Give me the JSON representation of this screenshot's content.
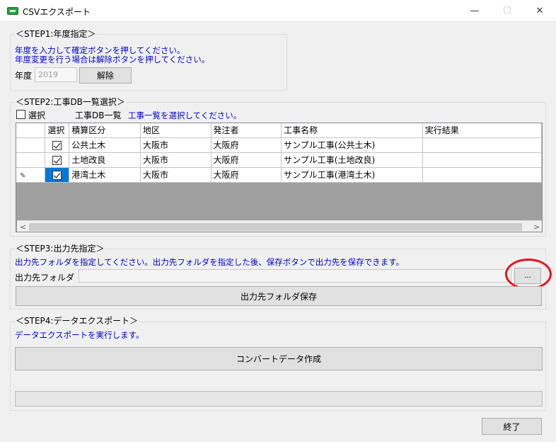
{
  "window": {
    "title": "CSVエクスポート",
    "minimize": "—",
    "maximize": "☐",
    "close": "✕"
  },
  "step1": {
    "title": "＜STEP1:年度指定＞",
    "desc1": "年度を入力して確定ボタンを押してください。",
    "desc2": "年度変更を行う場合は解除ボタンを押してください。",
    "year_label": "年度",
    "year_value": "2019",
    "release_button": "解除"
  },
  "step2": {
    "title": "＜STEP2:工事DB一覧選択＞",
    "select_label": "選択",
    "list_label": "工事DB一覧",
    "instruction": "工事一覧を選択してください。",
    "columns": [
      "選択",
      "積算区分",
      "地区",
      "発注者",
      "工事名称",
      "実行結果"
    ],
    "rows": [
      {
        "checked": true,
        "category": "公共土木",
        "district": "大阪市",
        "client": "大阪府",
        "name": "サンプル工事(公共土木)",
        "result": ""
      },
      {
        "checked": true,
        "category": "土地改良",
        "district": "大阪市",
        "client": "大阪府",
        "name": "サンプル工事(土地改良)",
        "result": ""
      },
      {
        "checked": true,
        "category": "港湾土木",
        "district": "大阪市",
        "client": "大阪府",
        "name": "サンプル工事(港湾土木)",
        "result": ""
      }
    ],
    "scroll_left": "<",
    "scroll_right": ">"
  },
  "step3": {
    "title": "＜STEP3:出力先指定＞",
    "desc": "出力先フォルダを指定してください。出力先フォルダを指定した後、保存ボタンで出力先を保存できます。",
    "folder_label": "出力先フォルダ",
    "folder_value": "",
    "browse_button": "...",
    "save_button": "出力先フォルダ保存"
  },
  "step4": {
    "title": "＜STEP4:データエクスポート＞",
    "desc": "データエクスポートを実行します。",
    "convert_button": "コンバートデータ作成",
    "progress": 0
  },
  "footer": {
    "close_button": "終了"
  },
  "colors": {
    "instruction_text": "#0000cd",
    "selection": "#0078d7",
    "highlight_circle": "#e0141c"
  }
}
